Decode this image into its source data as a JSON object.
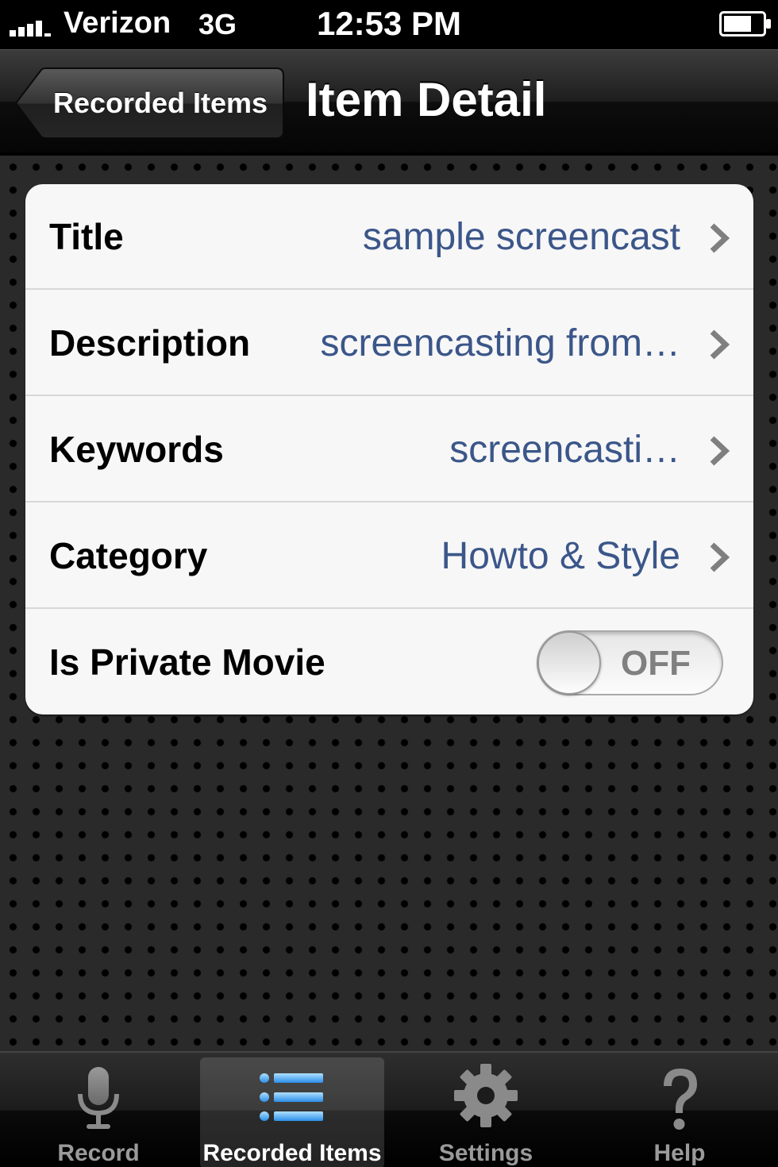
{
  "status_bar": {
    "carrier": "Verizon",
    "network": "3G",
    "time": "12:53 PM"
  },
  "nav_bar": {
    "back_label": "Recorded Items",
    "title": "Item Detail"
  },
  "detail_rows": [
    {
      "label": "Title",
      "value": "sample screencast"
    },
    {
      "label": "Description",
      "value": "screencasting from…"
    },
    {
      "label": "Keywords",
      "value": "screencasti…"
    },
    {
      "label": "Category",
      "value": "Howto & Style"
    }
  ],
  "private_row": {
    "label": "Is Private Movie",
    "toggle_state": "OFF"
  },
  "tab_bar": {
    "tabs": [
      {
        "label": "Record",
        "icon": "microphone-icon"
      },
      {
        "label": "Recorded Items",
        "icon": "list-icon",
        "selected": true
      },
      {
        "label": "Settings",
        "icon": "gear-icon"
      },
      {
        "label": "Help",
        "icon": "question-icon"
      }
    ]
  },
  "colors": {
    "value_text": "#3b5689",
    "selected_tab_icon": "#4aa8f5"
  }
}
